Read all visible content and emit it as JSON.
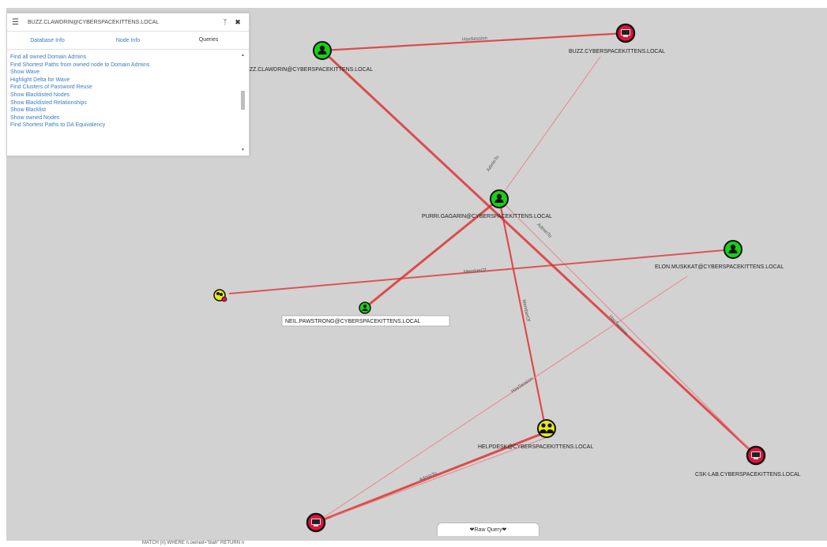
{
  "panel": {
    "search_value": "BUZZ.CLAWDRIN@CYBERSPACEKITTENS.LOCAL",
    "menu_icon": "hamburger-icon",
    "path_icon": "path-icon",
    "close_icon": "close-icon",
    "tabs": [
      "Database Info",
      "Node Info",
      "Queries"
    ],
    "active_tab": "Queries",
    "queries": [
      "Find all owned Domain Admins",
      "Find Shortest Paths from owned node to Domain Admins",
      "Show Wave",
      "Highlight Delta for Wave",
      "Find Clusters of Password Reuse",
      "Show Blacklisted Nodes",
      "Show Blacklisted Relationships",
      "Show Blacklist",
      "Show owned Nodes",
      "Find Shortest Paths to DA Equivalency"
    ]
  },
  "graph": {
    "nodes": {
      "buzz_user": "BUZZ.CLAWDRIN@CYBERSPACEKITTENS.LOCAL",
      "buzz_computer": "BUZZ.CYBERSPACEKITTENS.LOCAL",
      "yuri": "PURRI.GAGARIN@CYBERSPACEKITTENS.LOCAL",
      "elon": "ELON.MUSKKAT@CYBERSPACEKITTENS.LOCAL",
      "neil": "NEIL.PAWSTRONG@CYBERSPACEKITTENS.LOCAL",
      "helpdesk": "HELPDESK@CYBERSPACEKITTENS.LOCAL",
      "csklab": "CSK-LAB.CYBERSPACEKITTENS.LOCAL"
    },
    "edges": {
      "hassession_1": "HasSession",
      "adminto_1": "AdminTo",
      "adminto_2": "AdminTo",
      "memberof_1": "MemberOf",
      "memberof_2": "MemberOf",
      "hassession_2": "HasSession",
      "hassession_3": "HasSession",
      "adminto_3": "AdminTo"
    },
    "colors": {
      "background": "#d2d2d2",
      "user_node": "#17d117",
      "group_node": "#e9e917",
      "computer_node": "#e5113d",
      "edge": "#e03535"
    }
  },
  "raw_query": {
    "toggle_label": "❤Raw Query❤",
    "text": "MATCH (n) WHERE n.owned=\"blah\" RETURN n"
  }
}
